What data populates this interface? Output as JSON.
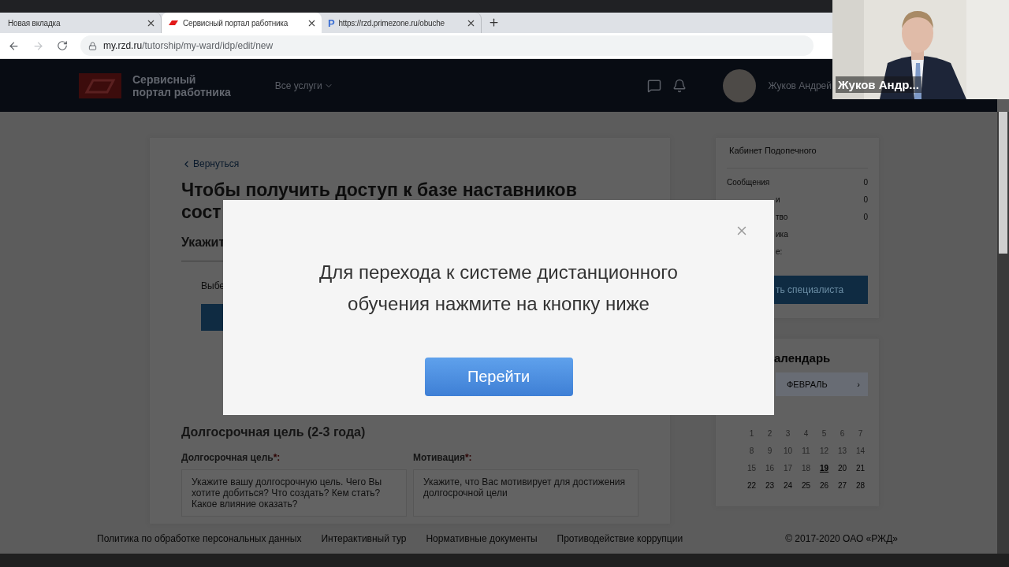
{
  "browser": {
    "tabs": [
      {
        "title": "Новая вкладка",
        "kind": "blank",
        "selected": false
      },
      {
        "title": "Сервисный портал работника",
        "kind": "rzd",
        "selected": true
      },
      {
        "title": "https://rzd.primezone.ru/obuche",
        "kind": "letter",
        "favicon_text": "P",
        "selected": false
      }
    ],
    "forward_disabled": true,
    "url_host": "my.rzd.ru",
    "url_path": "/tutorship/my-ward/idp/edit/new"
  },
  "header": {
    "brand": [
      "Сервисный",
      "портал работника"
    ],
    "services": "Все услуги",
    "user_name": "Жуков Андрей"
  },
  "main": {
    "back": "Вернуться",
    "heading": [
      "Чтобы получить доступ к базе наставников",
      "сост"
    ],
    "subheading": "Укажит",
    "select_placeholder": "Выбе",
    "goal_section": "Долгосрочная цель (2-3 года)",
    "fields": [
      {
        "label": "Долгосрочная цель",
        "required_mark": "*:",
        "placeholder": "Укажите вашу долгосрочную цель. Чего Вы хотите добиться? Что создать? Кем стать? Какое влияние оказать?"
      },
      {
        "label": "Мотивация",
        "required_mark": "*:",
        "placeholder": "Укажите, что Вас мотивирует для достижения долгосрочной цели"
      }
    ]
  },
  "sidebar": {
    "title": "Кабинет Подопечного",
    "rows": [
      {
        "kind": "full",
        "label": "Сообщения",
        "count": "0"
      },
      {
        "kind": "partial",
        "label": "и",
        "count": "0"
      },
      {
        "kind": "partial",
        "label": "тво",
        "count": "0"
      },
      {
        "kind": "partial",
        "label": "ика"
      },
      {
        "kind": "partial",
        "label": "е:"
      }
    ],
    "button": "ть специалиста",
    "calendar_title": "алендарь",
    "month": "ФЕВРАЛЬ",
    "next": "›",
    "days": [
      {
        "day": "1",
        "past": true,
        "selected": false
      },
      {
        "day": "2",
        "past": true,
        "selected": false
      },
      {
        "day": "3",
        "past": true,
        "selected": false
      },
      {
        "day": "4",
        "past": true,
        "selected": false
      },
      {
        "day": "5",
        "past": true,
        "selected": false
      },
      {
        "day": "6",
        "past": true,
        "selected": false
      },
      {
        "day": "7",
        "past": true,
        "selected": false
      },
      {
        "day": "8",
        "past": true,
        "selected": false
      },
      {
        "day": "9",
        "past": true,
        "selected": false
      },
      {
        "day": "10",
        "past": true,
        "selected": false
      },
      {
        "day": "11",
        "past": true,
        "selected": false
      },
      {
        "day": "12",
        "past": true,
        "selected": false
      },
      {
        "day": "13",
        "past": true,
        "selected": false
      },
      {
        "day": "14",
        "past": true,
        "selected": false
      },
      {
        "day": "15",
        "past": true,
        "selected": false
      },
      {
        "day": "16",
        "past": true,
        "selected": false
      },
      {
        "day": "17",
        "past": true,
        "selected": false
      },
      {
        "day": "18",
        "past": true,
        "selected": false
      },
      {
        "day": "19",
        "past": false,
        "selected": true
      },
      {
        "day": "20",
        "past": false,
        "selected": false
      },
      {
        "day": "21",
        "past": false,
        "selected": false
      },
      {
        "day": "22",
        "past": false,
        "selected": false
      },
      {
        "day": "23",
        "past": false,
        "selected": false
      },
      {
        "day": "24",
        "past": false,
        "selected": false
      },
      {
        "day": "25",
        "past": false,
        "selected": false
      },
      {
        "day": "26",
        "past": false,
        "selected": false
      },
      {
        "day": "27",
        "past": false,
        "selected": false
      },
      {
        "day": "28",
        "past": false,
        "selected": false
      }
    ]
  },
  "footer": {
    "links": [
      "Политика по обработке персональных данных",
      "Интерактивный тур",
      "Нормативные документы",
      "Противодействие коррупции"
    ],
    "copyright": "© 2017-2020 ОАО «РЖД»"
  },
  "modal": {
    "message": [
      "Для перехода к системе дистанционного",
      "обучения нажмите на кнопку ниже"
    ],
    "button": "Перейти"
  },
  "video": {
    "kind": "picture",
    "name": "Жуков Андр..."
  }
}
